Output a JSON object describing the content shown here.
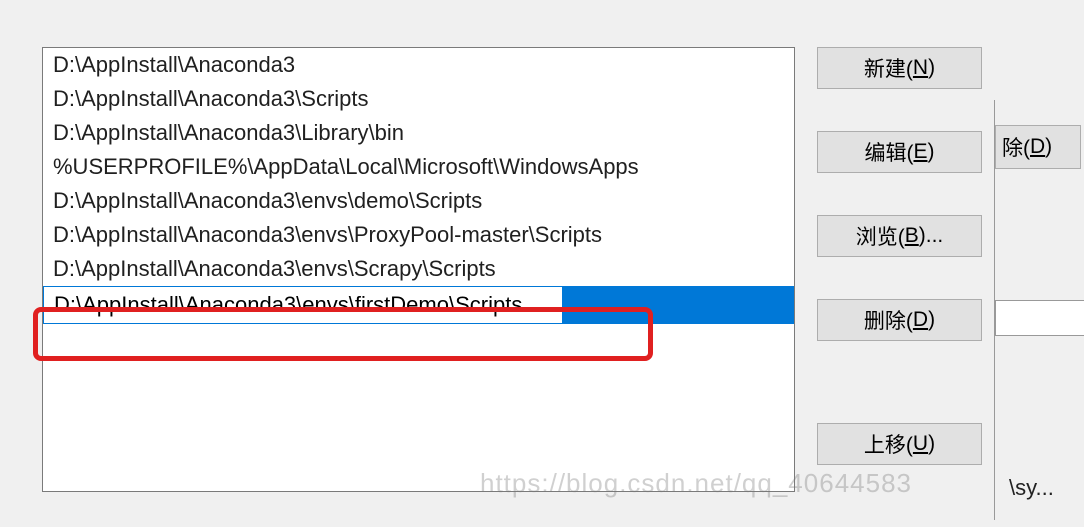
{
  "path_list": {
    "items": [
      "D:\\AppInstall\\Anaconda3",
      "D:\\AppInstall\\Anaconda3\\Scripts",
      "D:\\AppInstall\\Anaconda3\\Library\\bin",
      "%USERPROFILE%\\AppData\\Local\\Microsoft\\WindowsApps",
      "D:\\AppInstall\\Anaconda3\\envs\\demo\\Scripts",
      "D:\\AppInstall\\Anaconda3\\envs\\ProxyPool-master\\Scripts",
      "D:\\AppInstall\\Anaconda3\\envs\\Scrapy\\Scripts"
    ],
    "editing_value": "D:\\AppInstall\\Anaconda3\\envs\\firstDemo\\Scripts"
  },
  "buttons": {
    "new": {
      "text": "新建(",
      "key": "N",
      "tail": ")"
    },
    "edit": {
      "text": "编辑(",
      "key": "E",
      "tail": ")"
    },
    "browse": {
      "text": "浏览(",
      "key": "B",
      "tail": ")..."
    },
    "delete": {
      "text": "删除(",
      "key": "D",
      "tail": ")"
    },
    "moveup": {
      "text": "上移(",
      "key": "U",
      "tail": ")"
    }
  },
  "behind": {
    "delete_label_prefix": "除(",
    "delete_key": "D",
    "delete_label_suffix": ")",
    "text_fragment": "\\sy..."
  },
  "watermark": "https://blog.csdn.net/qq_40644583"
}
